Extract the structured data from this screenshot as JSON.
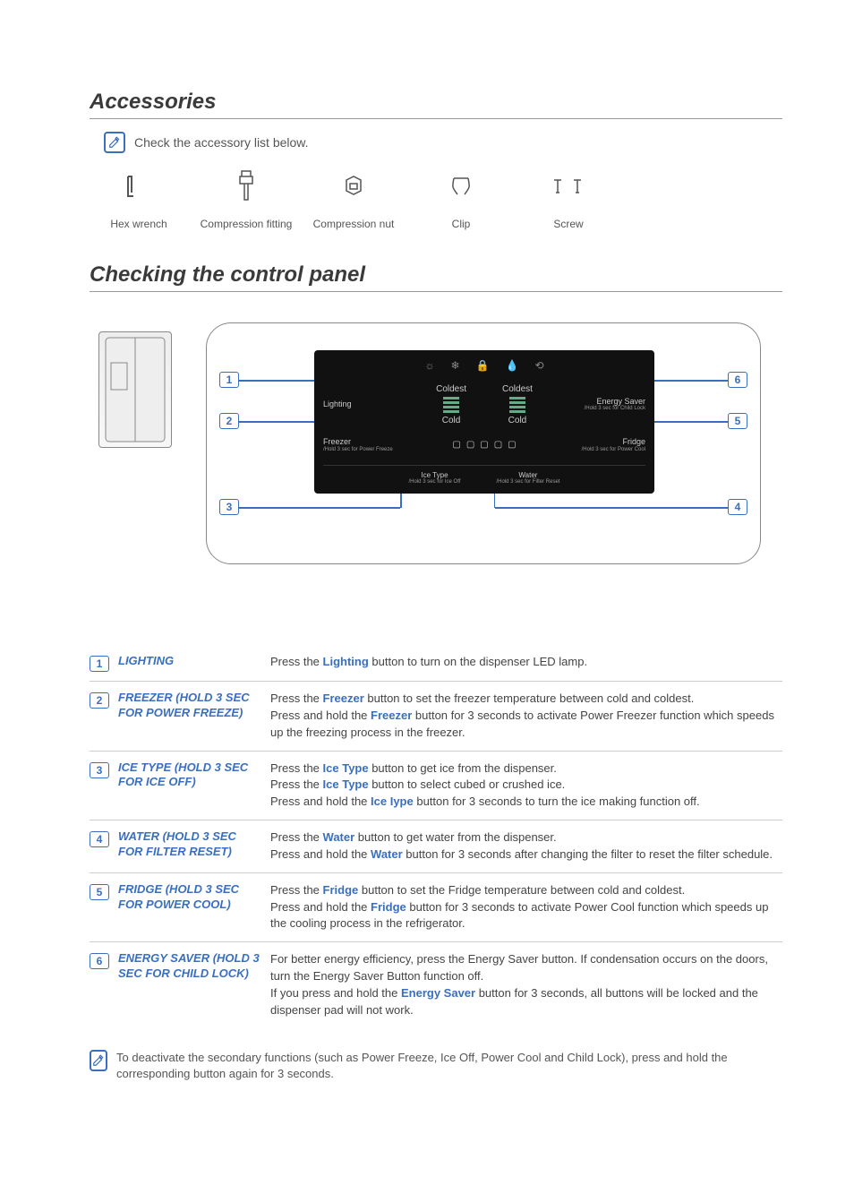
{
  "sections": {
    "accessories_title": "Accessories",
    "accessories_note": "Check the accessory list below.",
    "control_title": "Checking the control panel"
  },
  "accessories": [
    {
      "label": "Hex wrench"
    },
    {
      "label": "Compression fitting"
    },
    {
      "label": "Compression nut"
    },
    {
      "label": "Clip"
    },
    {
      "label": "Screw"
    }
  ],
  "panel": {
    "lighting": "Lighting",
    "energy_saver": "Energy Saver",
    "energy_saver_sub": "/Hold 3 sec for Child Lock",
    "freezer": "Freezer",
    "freezer_sub": "/Hold 3 sec for Power Freeze",
    "fridge": "Fridge",
    "fridge_sub": "/Hold 3 sec for Power Cool",
    "ice_type": "Ice Type",
    "ice_type_sub": "/Hold 3 sec for Ice Off",
    "water": "Water",
    "water_sub": "/Hold 3 sec for Filter Reset",
    "coldest": "Coldest",
    "cold": "Cold"
  },
  "tags": {
    "t1": "1",
    "t2": "2",
    "t3": "3",
    "t4": "4",
    "t5": "5",
    "t6": "6"
  },
  "functions": [
    {
      "num": "1",
      "head": "LIGHTING",
      "body": "Press the <kw>Lighting</kw> button to turn on the dispenser LED lamp."
    },
    {
      "num": "2",
      "head": "FREEZER\n(HOLD 3 SEC FOR POWER FREEZE)",
      "body": "Press the <kw>Freezer</kw> button to set the freezer temperature between cold and coldest.\nPress and hold the <kw>Freezer</kw> button for 3 seconds to activate Power Freezer function which speeds up the freezing process in the freezer."
    },
    {
      "num": "3",
      "head": "ICE TYPE\n(HOLD 3 SEC FOR ICE OFF)",
      "body": "Press the <kw>Ice Type</kw> button to get ice from the dispenser.\nPress the <kw>Ice Type</kw> button to select cubed or crushed ice.\nPress and hold the <kw>Ice Iype</kw> button for 3 seconds to turn the ice making function off."
    },
    {
      "num": "4",
      "head": "WATER (HOLD 3 SEC FOR FILTER RESET)",
      "body": "Press the <kw>Water</kw> button to get water from the dispenser.\nPress and hold the <kw>Water</kw> button for 3 seconds after changing the filter to reset the filter schedule."
    },
    {
      "num": "5",
      "head": "FRIDGE (HOLD 3 SEC FOR POWER COOL)",
      "body": "Press the <kw>Fridge</kw> button to set the Fridge temperature between cold and coldest.\nPress and hold the <kw>Fridge</kw> button for 3 seconds to activate Power Cool function which speeds up the cooling process in the refrigerator."
    },
    {
      "num": "6",
      "head": "ENERGY SAVER (HOLD 3 SEC FOR CHILD LOCK)",
      "body": "For better energy efficiency, press the Energy Saver button. If condensation occurs on the doors, turn the Energy Saver Button function off.\nIf you press and hold the <kw>Energy Saver</kw> button for 3 seconds, all buttons will be locked and the dispenser pad will not work."
    }
  ],
  "bottom_note": "To deactivate the secondary functions (such as Power Freeze, Ice Off, Power Cool and Child Lock), press and hold the corresponding button again for 3 seconds."
}
